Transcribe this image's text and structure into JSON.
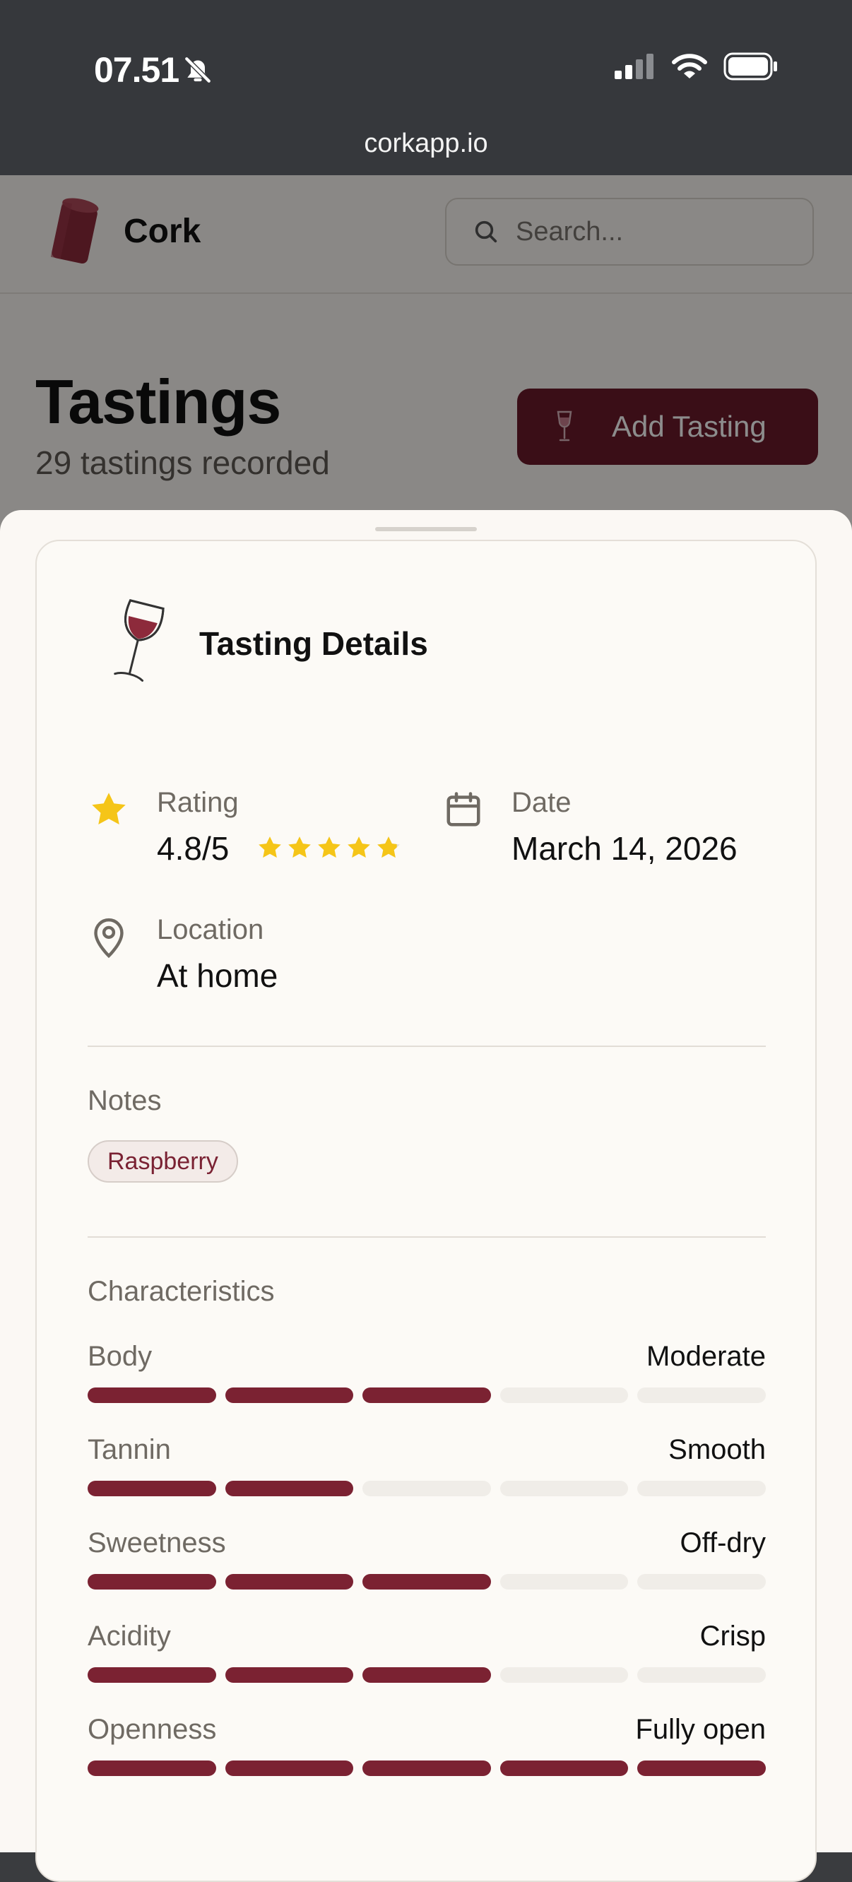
{
  "status_bar": {
    "time": "07.51",
    "url": "corkapp.io"
  },
  "header": {
    "brand": "Cork",
    "search_placeholder": "Search..."
  },
  "page": {
    "title": "Tastings",
    "subtitle": "29 tastings recorded",
    "add_button": "Add Tasting"
  },
  "sheet": {
    "title": "Tasting Details",
    "rating": {
      "label": "Rating",
      "value": "4.8/5",
      "stars": 4.8
    },
    "date": {
      "label": "Date",
      "value": "March 14, 2026"
    },
    "location": {
      "label": "Location",
      "value": "At home"
    },
    "notes": {
      "label": "Notes",
      "tags": [
        "Raspberry"
      ]
    },
    "characteristics": {
      "label": "Characteristics",
      "items": [
        {
          "name": "Body",
          "value": "Moderate",
          "level": 3,
          "max": 5
        },
        {
          "name": "Tannin",
          "value": "Smooth",
          "level": 2,
          "max": 5
        },
        {
          "name": "Sweetness",
          "value": "Off-dry",
          "level": 3,
          "max": 5
        },
        {
          "name": "Acidity",
          "value": "Crisp",
          "level": 3,
          "max": 5
        },
        {
          "name": "Openness",
          "value": "Fully open",
          "level": 5,
          "max": 5
        }
      ]
    }
  },
  "colors": {
    "accent": "#7b2232",
    "button": "#6b1a2a",
    "star": "#f5c518"
  }
}
